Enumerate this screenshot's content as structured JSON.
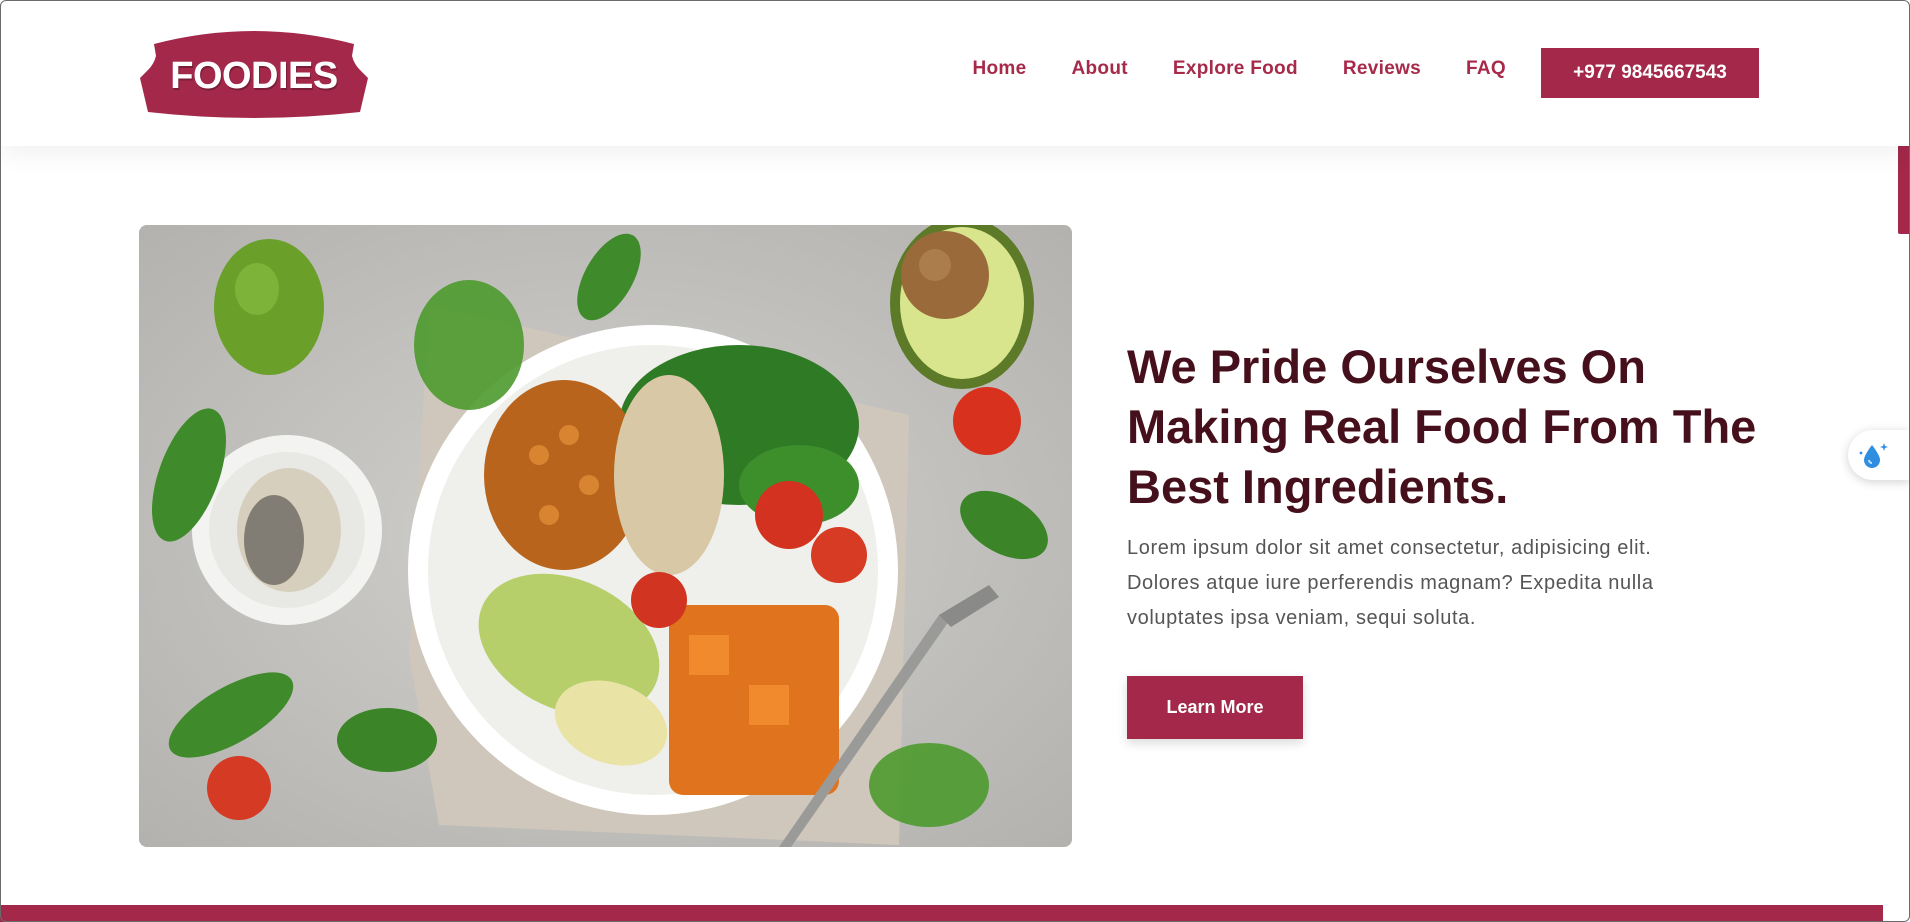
{
  "brand": {
    "logo_text": "FOODIES",
    "color": "#a3284a"
  },
  "nav": {
    "links": [
      "Home",
      "About",
      "Explore Food",
      "Reviews",
      "FAQ"
    ],
    "phone": "+977 9845667543"
  },
  "hero": {
    "title": "We Pride Ourselves On Making Real Food From The Best Ingredients.",
    "description": "Lorem ipsum dolor sit amet consectetur, adipisicing elit. Dolores atque iure perferendis magnam? Expedita nulla voluptates ipsa veniam, sequi soluta.",
    "button_label": "Learn More",
    "image_icon": "salad-bowl-photo"
  },
  "widget": {
    "icon": "water-drop-sparkle-icon"
  },
  "colors": {
    "accent": "#a3284a",
    "heading": "#45101c",
    "body_text": "#555555"
  }
}
